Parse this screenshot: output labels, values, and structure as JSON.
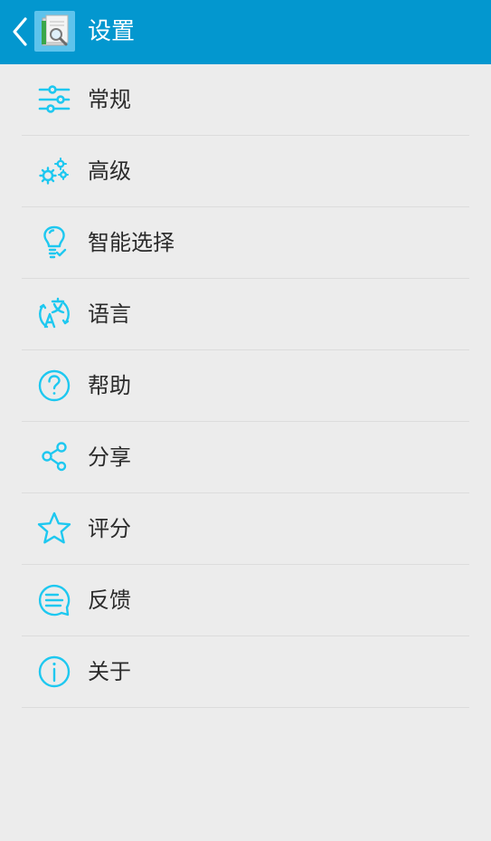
{
  "header": {
    "title": "设置",
    "back_icon": "chevron-left-icon",
    "app_icon": "document-search-icon",
    "background_color": "#0397cf"
  },
  "accent_color": "#1ec8f0",
  "menu": {
    "items": [
      {
        "label": "常规",
        "icon": "sliders-icon"
      },
      {
        "label": "高级",
        "icon": "gears-icon"
      },
      {
        "label": "智能选择",
        "icon": "lightbulb-icon"
      },
      {
        "label": "语言",
        "icon": "translate-icon"
      },
      {
        "label": "帮助",
        "icon": "help-icon"
      },
      {
        "label": "分享",
        "icon": "share-icon"
      },
      {
        "label": "评分",
        "icon": "star-icon"
      },
      {
        "label": "反馈",
        "icon": "feedback-icon"
      },
      {
        "label": "关于",
        "icon": "info-icon"
      }
    ]
  }
}
